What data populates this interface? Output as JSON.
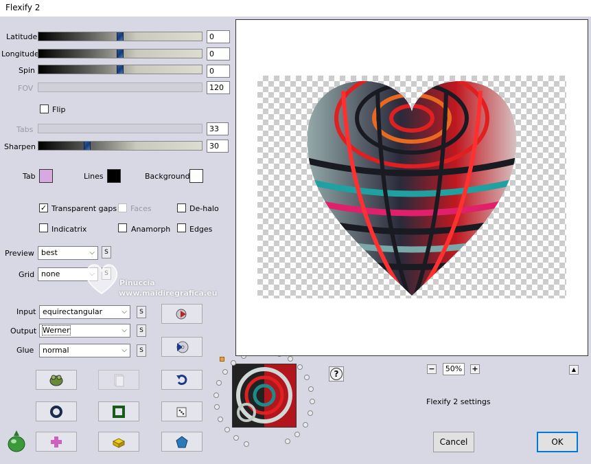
{
  "window": {
    "title": "Flexify 2"
  },
  "sliders": [
    {
      "label": "Latitude",
      "value": "0",
      "level": 0.5,
      "enabled": true
    },
    {
      "label": "Longitude",
      "value": "0",
      "level": 0.5,
      "enabled": true
    },
    {
      "label": "Spin",
      "value": "0",
      "level": 0.5,
      "enabled": true
    },
    {
      "label": "FOV",
      "value": "120",
      "enabled": false
    },
    {
      "label": "Tabs",
      "value": "33",
      "enabled": false
    },
    {
      "label": "Sharpen",
      "value": "30",
      "level": 0.3,
      "enabled": true
    }
  ],
  "flip": {
    "label": "Flip",
    "checked": false
  },
  "colors": {
    "tab": {
      "label": "Tab",
      "color": "#d8a8e0"
    },
    "lines": {
      "label": "Lines",
      "color": "#000000"
    },
    "background": {
      "label": "Background",
      "color": "#ffffff"
    }
  },
  "options": {
    "transparent_gaps": {
      "label": "Transparent gaps",
      "checked": true
    },
    "faces": {
      "label": "Faces",
      "checked": false,
      "enabled": false
    },
    "de_halo": {
      "label": "De-halo",
      "checked": false
    },
    "indicatrix": {
      "label": "Indicatrix",
      "checked": false
    },
    "anamorph": {
      "label": "Anamorph",
      "checked": false
    },
    "edges": {
      "label": "Edges",
      "checked": false
    }
  },
  "selects": {
    "preview": {
      "label": "Preview",
      "value": "best"
    },
    "grid": {
      "label": "Grid",
      "value": "none"
    },
    "input": {
      "label": "Input",
      "value": "equirectangular"
    },
    "output": {
      "label": "Output",
      "value": "Werner"
    },
    "glue": {
      "label": "Glue",
      "value": "normal"
    }
  },
  "s_label": "S",
  "watermark": {
    "line1": "Pinuccia",
    "line2": "www.maidiregrafica.eu"
  },
  "zoom": {
    "minus": "−",
    "value": "50%",
    "plus": "+"
  },
  "help_label": "?",
  "collapse_label": "▲",
  "settings_label": "Flexify 2 settings",
  "buttons": {
    "cancel": "Cancel",
    "ok": "OK"
  },
  "icons": {
    "play": "play-arrow-icon",
    "play_disc": "play-disc-icon",
    "undo": "undo-arrow-icon",
    "ring": "ring-icon",
    "square": "green-square-icon",
    "dice": "dice-icon",
    "cross": "pink-cross-icon",
    "brick": "yellow-brick-icon",
    "gem": "blue-gem-icon",
    "logo": "flaming-pear-logo"
  }
}
